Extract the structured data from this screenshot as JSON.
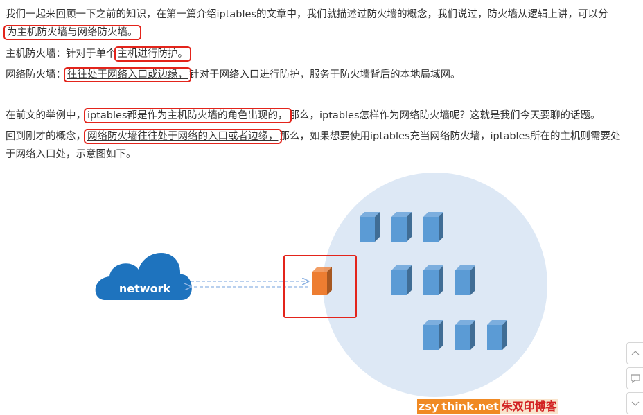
{
  "article": {
    "p1": {
      "text": "我们一起来回顾一下之前的知识，在第一篇介绍iptables的文章中，我们就描述过防火墙的概念，我们说过，防火墙从逻辑上讲，可以分",
      "text_line2_hl": "为主机防火墙与网络防火墙。"
    },
    "p2": {
      "prefix": "主机防火墙：针对于单个",
      "hl": "主机进行防护。"
    },
    "p3": {
      "prefix": "网络防火墙：",
      "hl": "往往处于网络入口或边缘，",
      "suffix": "针对于网络入口进行防护，服务于防火墙背后的本地局域网。"
    },
    "p4": {
      "prefix": "在前文的举例中，",
      "hl": "iptables都是作为主机防火墙的角色出现的，",
      "suffix": "那么，iptables怎样作为网络防火墙呢？这就是我们今天要聊的话题。"
    },
    "p5": {
      "prefix": "回到刚才的概念，",
      "hl": "网络防火墙往往处于网络的入口或者边缘，",
      "suffix": "那么，如果想要使用iptables充当网络防火墙，iptables所在的主机则需要处",
      "line2": "于网络入口处，示意图如下。"
    }
  },
  "diagram": {
    "cloud_label": "network",
    "colors": {
      "cloud": "#1e73be",
      "lan_circle": "#dde8f5",
      "host": "#5b9bd5",
      "firewall": "#ed7d31",
      "highlight": "#e3241b",
      "arrow": "#8fb4e3"
    }
  },
  "watermark": {
    "part1": "zsy",
    "part2": "think.net",
    "part3": "朱双印博客"
  },
  "sidebar": {
    "buttons": [
      "chevron-up-icon",
      "comment-icon",
      "chevron-down-icon"
    ]
  }
}
